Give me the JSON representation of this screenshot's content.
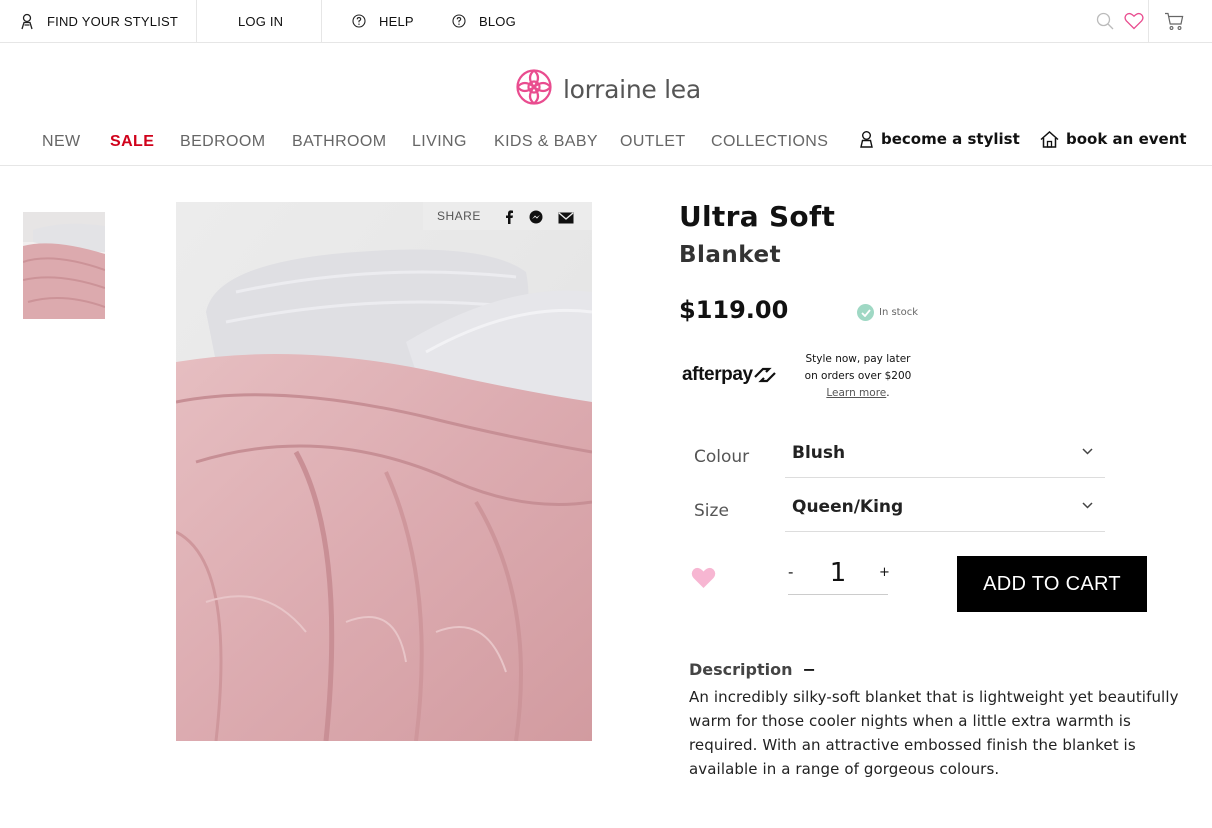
{
  "topbar": {
    "find_stylist": "FIND YOUR STYLIST",
    "login": "LOG IN",
    "help": "HELP",
    "blog": "BLOG"
  },
  "brand": {
    "name": "lorraine lea",
    "accent": "#e94c8f"
  },
  "nav": {
    "items": [
      "NEW",
      "SALE",
      "BEDROOM",
      "BATHROOM",
      "LIVING",
      "KIDS & BABY",
      "OUTLET",
      "COLLECTIONS"
    ],
    "become_stylist": "become a stylist",
    "book_event": "book an event",
    "sale_color": "#d0021b"
  },
  "share": {
    "label": "SHARE"
  },
  "product": {
    "title": "Ultra Soft",
    "subtitle": "Blanket",
    "price": "$119.00",
    "stock": "In stock",
    "stock_color": "#9fd8c4"
  },
  "afterpay": {
    "logo": "afterpay",
    "line1": "Style now, pay later",
    "line2": "on orders over $200",
    "learn_more": "Learn more"
  },
  "options": {
    "colour_label": "Colour",
    "colour_value": "Blush",
    "size_label": "Size",
    "size_value": "Queen/King"
  },
  "cart": {
    "minus": "-",
    "quantity": "1",
    "plus": "+",
    "add_label": "ADD TO CART"
  },
  "description": {
    "heading": "Description",
    "toggle": "−",
    "body": "An incredibly silky-soft blanket that is lightweight yet beautifully warm for those cooler nights when a little extra warmth is required. With an attractive embossed finish the blanket is available in a range of gorgeous colours."
  },
  "icons": {
    "stylist": "person-pin-icon",
    "help": "question-circle-icon",
    "blog": "question-circle-icon",
    "search": "search-icon",
    "wishlist": "heart-outline-icon",
    "cart": "cart-icon",
    "facebook": "facebook-icon",
    "messenger": "messenger-icon",
    "email": "envelope-icon"
  }
}
